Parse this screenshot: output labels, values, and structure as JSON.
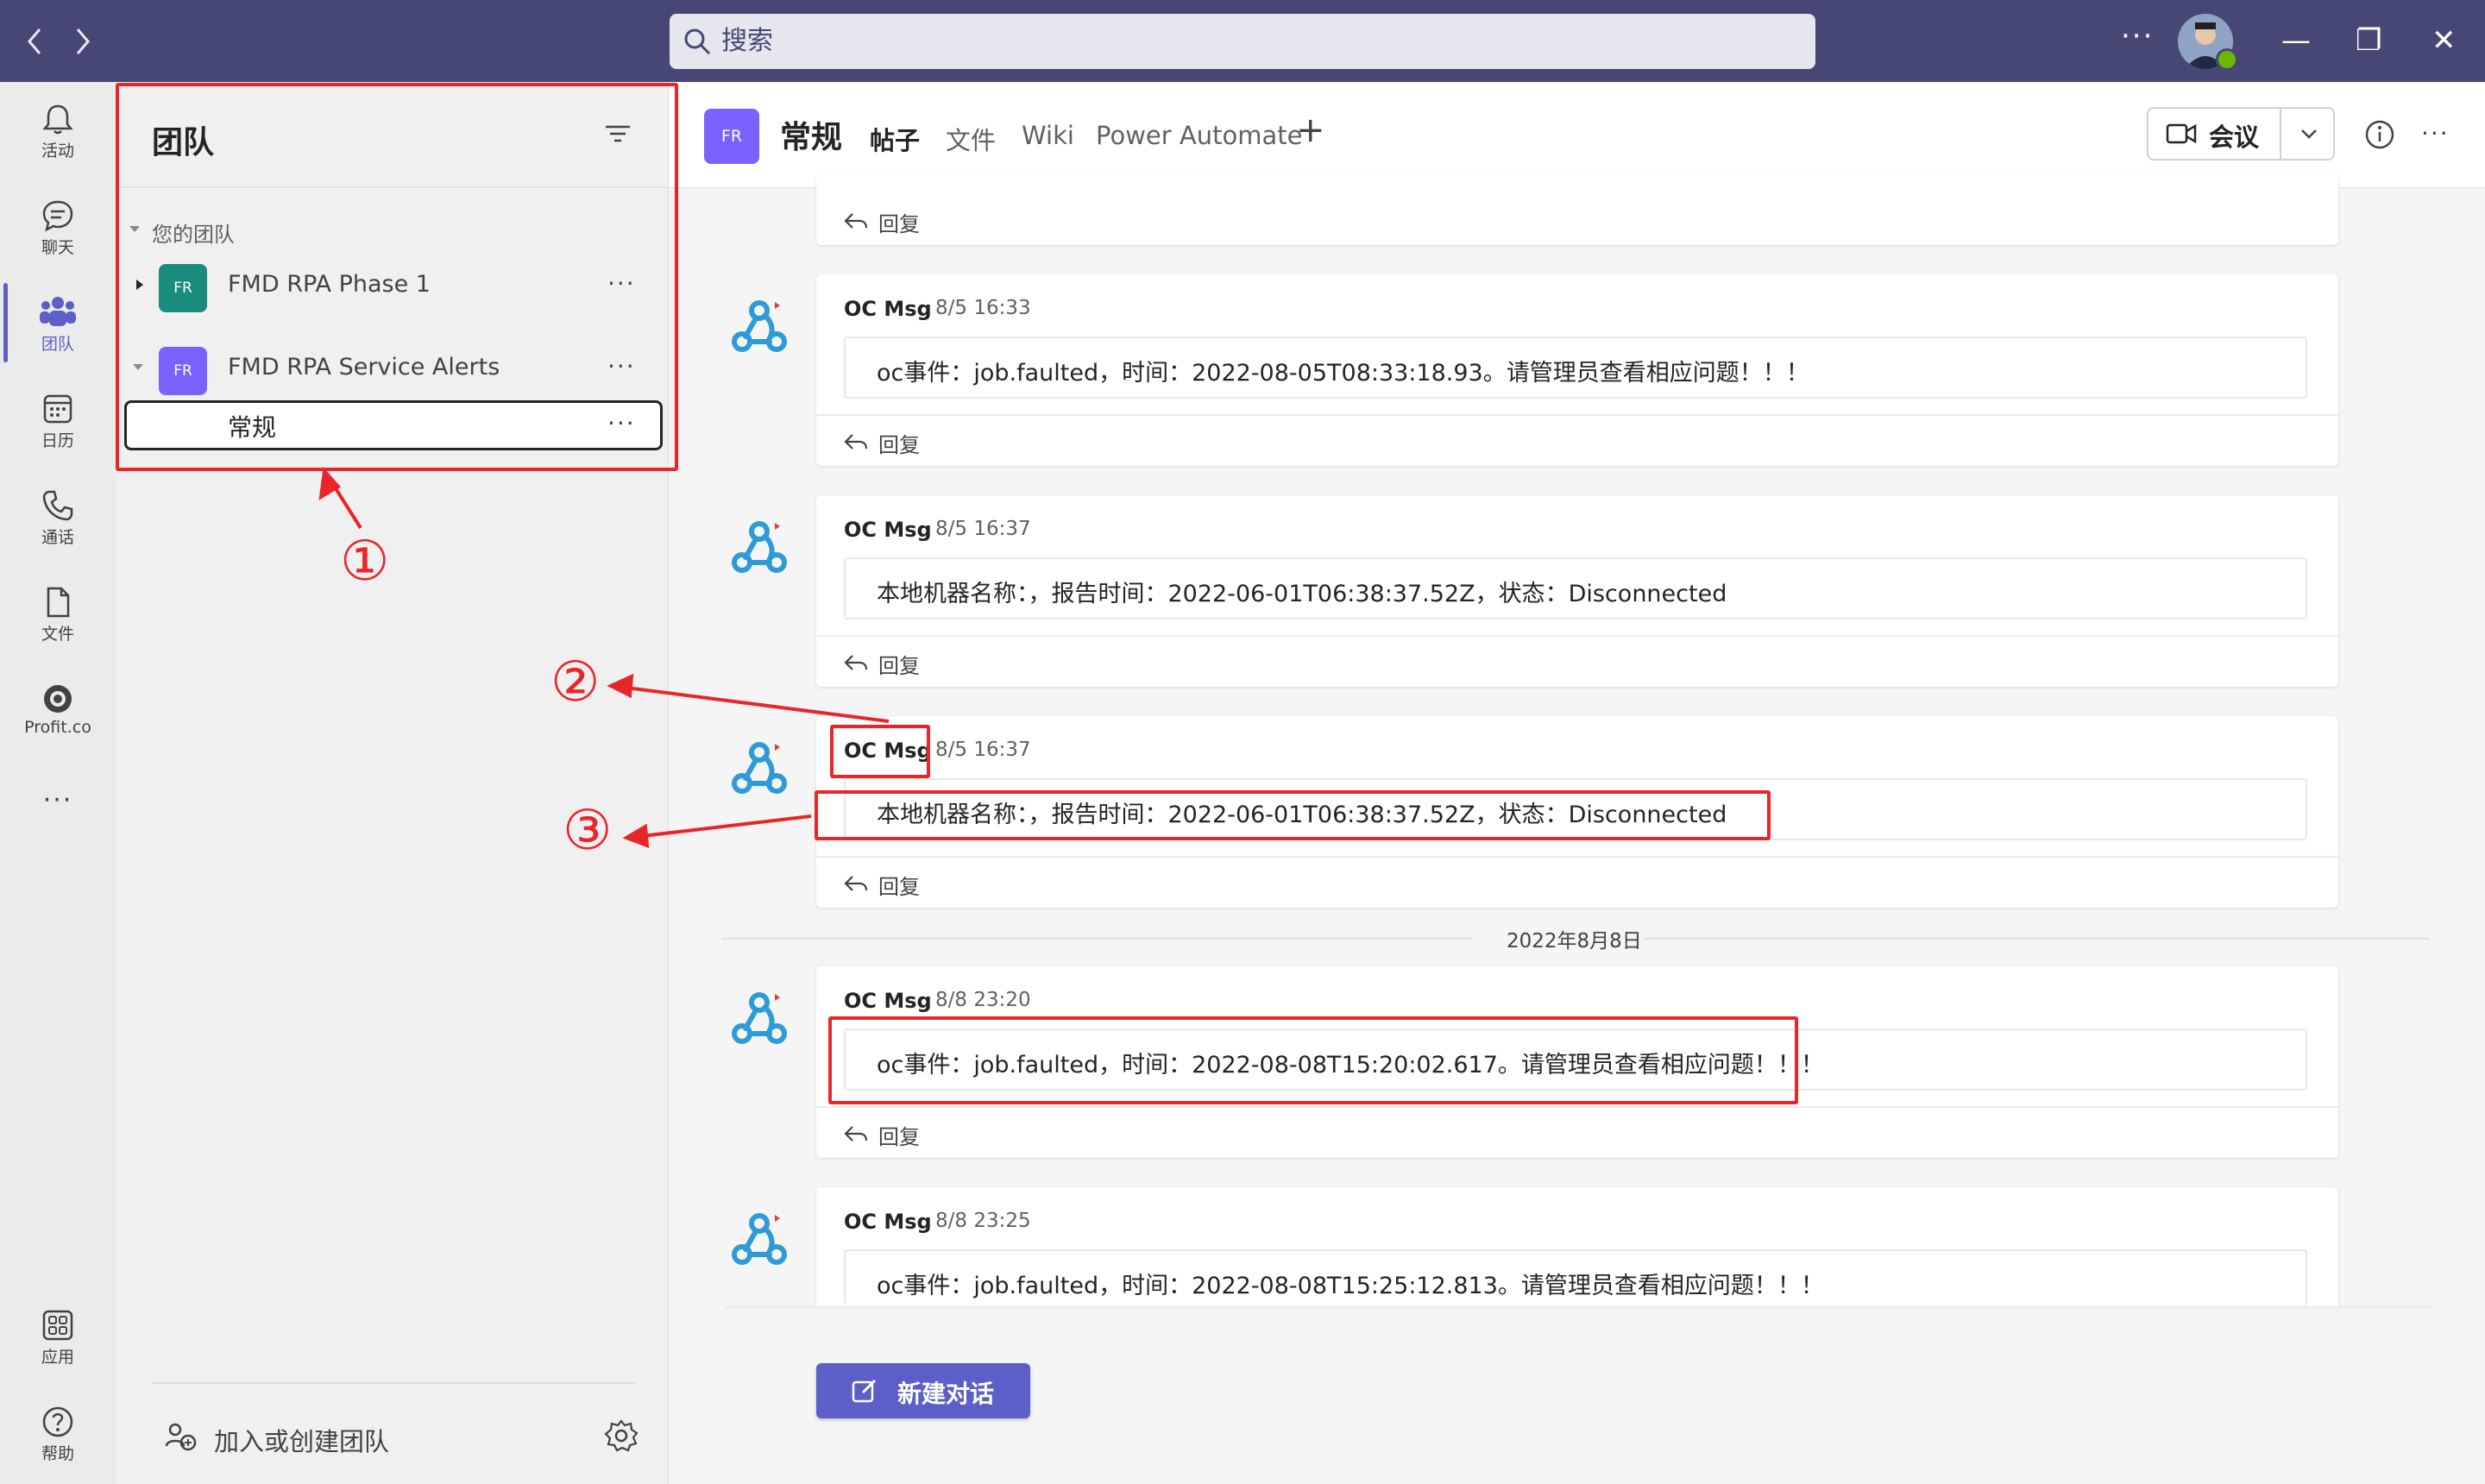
{
  "titlebar": {
    "back_icon": "chevron-left-icon",
    "forward_icon": "chevron-right-icon",
    "search_placeholder": "搜索",
    "more": "···",
    "minimize": "—",
    "maximize": "❐",
    "close": "✕"
  },
  "rail": {
    "items": [
      {
        "label": "活动",
        "icon": "bell-icon"
      },
      {
        "label": "聊天",
        "icon": "chat-icon"
      },
      {
        "label": "团队",
        "icon": "teams-icon"
      },
      {
        "label": "日历",
        "icon": "calendar-icon"
      },
      {
        "label": "通话",
        "icon": "phone-icon"
      },
      {
        "label": "文件",
        "icon": "file-icon"
      },
      {
        "label": "Profit.co",
        "icon": "profitco-icon"
      }
    ],
    "more": "···",
    "bottom_items": [
      {
        "label": "应用",
        "icon": "apps-icon"
      },
      {
        "label": "帮助",
        "icon": "help-icon"
      }
    ]
  },
  "teams_panel": {
    "title": "团队",
    "section_label": "您的团队",
    "teams": [
      {
        "tile": "FR",
        "name": "FMD RPA Phase 1",
        "more": "···",
        "tile_color": "#1a8c7e"
      },
      {
        "tile": "FR",
        "name": "FMD RPA Service Alerts",
        "more": "···",
        "tile_color": "#7b61ff"
      }
    ],
    "channel": {
      "name": "常规",
      "more": "···"
    },
    "join_label": "加入或创建团队"
  },
  "channel_header": {
    "tile": "FR",
    "title": "常规",
    "tabs": [
      "帖子",
      "文件",
      "Wiki",
      "Power Automate"
    ],
    "add_tab": "+",
    "meet_label": "会议"
  },
  "feed": {
    "reply_label": "回复",
    "date_divider": "2022年8月8日",
    "posts": [
      {
        "author": "OC Msg",
        "time": "8/5 16:33",
        "message": "oc事件：job.faulted，时间：2022-08-05T08:33:18.93。请管理员查看相应问题！！！"
      },
      {
        "author": "OC Msg",
        "time": "8/5 16:37",
        "message": "本地机器名称：，报告时间：2022-06-01T06:38:37.52Z，状态：Disconnected"
      },
      {
        "author": "OC Msg",
        "time": "8/5 16:37",
        "message": "本地机器名称：，报告时间：2022-06-01T06:38:37.52Z，状态：Disconnected"
      },
      {
        "author": "OC Msg",
        "time": "8/8 23:20",
        "message": "oc事件：job.faulted，时间：2022-08-08T15:20:02.617。请管理员查看相应问题！！！"
      },
      {
        "author": "OC Msg",
        "time": "8/8 23:25",
        "message": "oc事件：job.faulted，时间：2022-08-08T15:25:12.813。请管理员查看相应问题！！！"
      }
    ],
    "new_conversation": "新建对话"
  },
  "annotations": {
    "marker_1": "①",
    "marker_2": "②",
    "marker_3": "③",
    "color": "#e8262a"
  },
  "colors": {
    "titlebar": "#464775",
    "accent": "#5b5fc7",
    "bot_icon": "#2e9bd6"
  }
}
